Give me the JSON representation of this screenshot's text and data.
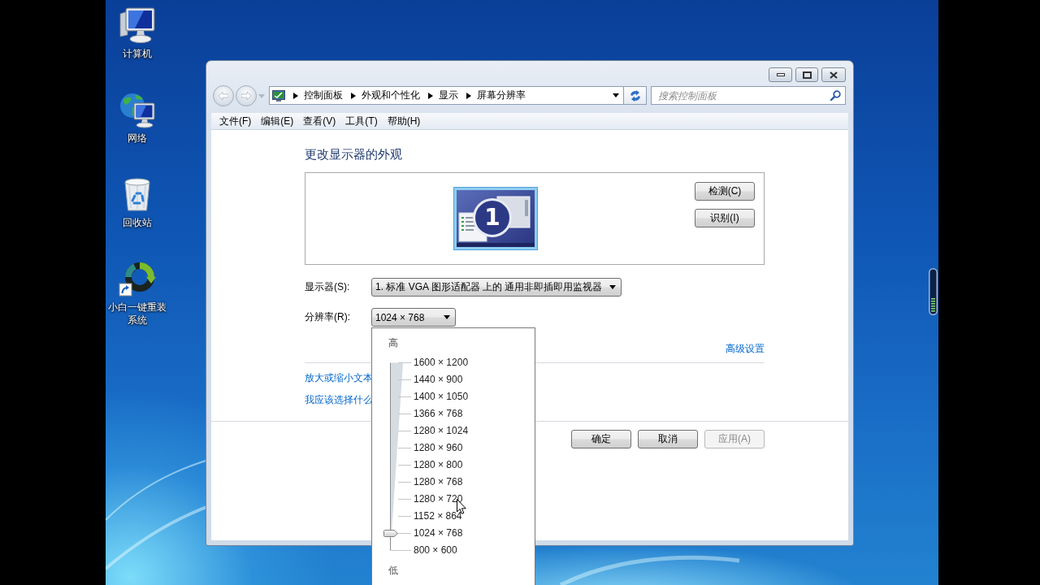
{
  "desktop_icons": [
    {
      "kind": "computer",
      "label": "计算机"
    },
    {
      "kind": "network",
      "label": "网络"
    },
    {
      "kind": "recycle_bin",
      "label": "回收站"
    },
    {
      "kind": "shortcut",
      "label": "小白一键重装系统"
    }
  ],
  "window": {
    "address_path": [
      "控制面板",
      "外观和个性化",
      "显示",
      "屏幕分辨率"
    ],
    "search": {
      "placeholder": "搜索控制面板"
    },
    "menu": [
      "文件(F)",
      "编辑(E)",
      "查看(V)",
      "工具(T)",
      "帮助(H)"
    ],
    "heading": "更改显示器的外观",
    "monitor": {
      "number": "1"
    },
    "monitor_buttons": [
      "检测(C)",
      "识别(I)"
    ],
    "fields": [
      {
        "label": "显示器(S):",
        "value": "1. 标准 VGA 图形适配器 上的 通用非即插即用监视器"
      },
      {
        "label": "分辨率(R):",
        "value": "1024 × 768"
      }
    ],
    "advanced_link": "高级设置",
    "links": [
      "放大或缩小文本",
      "我应该选择什么"
    ],
    "buttons": [
      {
        "label": "确定",
        "disabled": false
      },
      {
        "label": "取消",
        "disabled": false
      },
      {
        "label": "应用(A)",
        "disabled": true
      }
    ]
  },
  "resolution_popup": {
    "high_label": "高",
    "slider": {
      "level": 0.0909
    },
    "options": [
      "1600 × 1200",
      "1440 × 900",
      "1400 × 1050",
      "1366 × 768",
      "1280 × 1024",
      "1280 × 960",
      "1280 × 800",
      "1280 × 768",
      "1280 × 720",
      "1152 × 864",
      "1024 × 768",
      "800 × 600"
    ],
    "low_label": "低"
  }
}
